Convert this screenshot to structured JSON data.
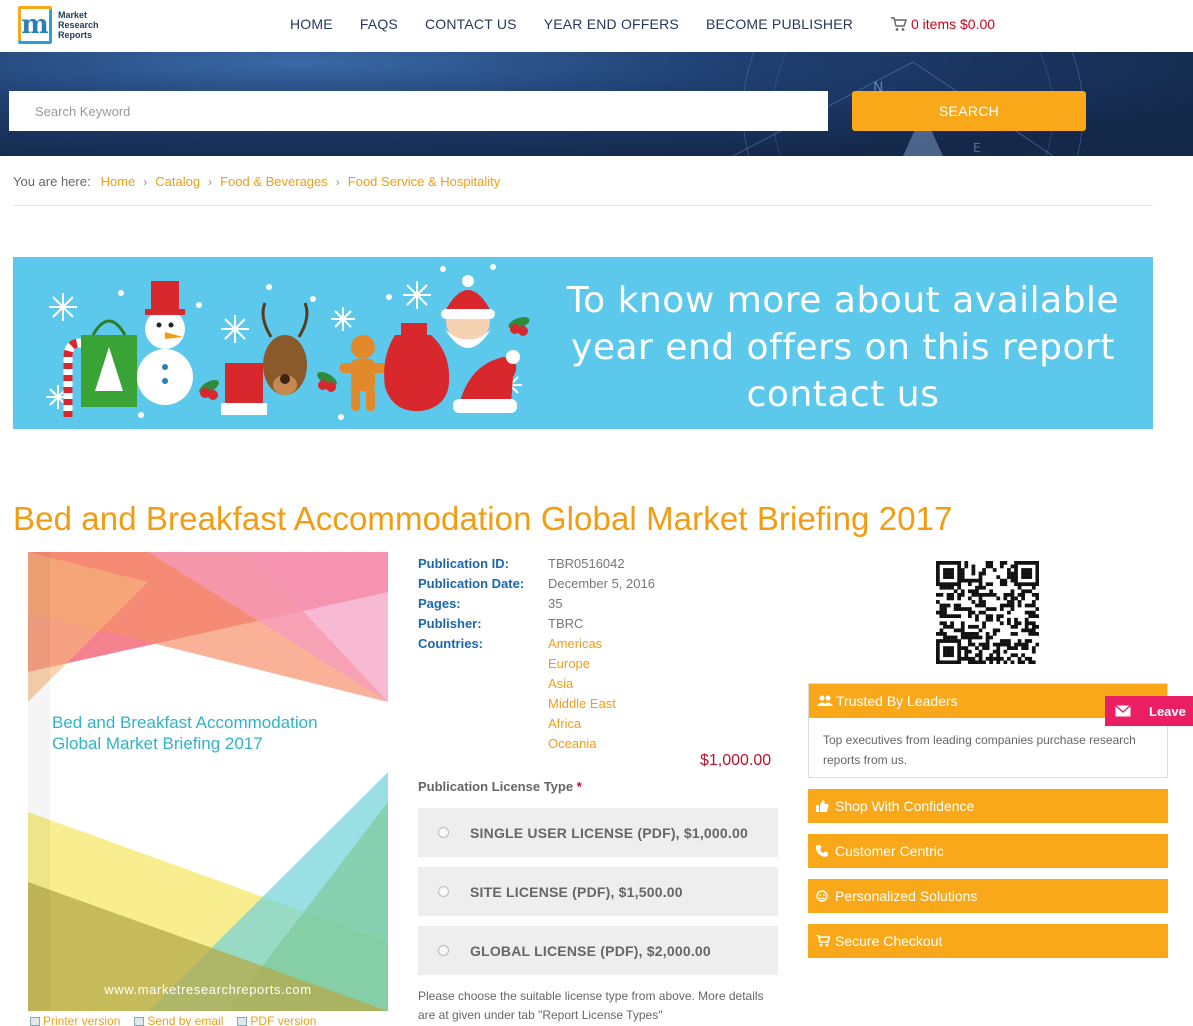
{
  "header": {
    "logo_text_1": "Market",
    "logo_text_2": "Research",
    "logo_text_3": "Reports",
    "nav": [
      "HOME",
      "FAQS",
      "CONTACT US",
      "YEAR END OFFERS",
      "BECOME PUBLISHER"
    ],
    "cart": "0 items $0.00"
  },
  "search": {
    "placeholder": "Search Keyword",
    "button": "SEARCH"
  },
  "breadcrumb": {
    "prefix": "You are here:",
    "items": [
      "Home",
      "Catalog",
      "Food & Beverages",
      "Food Service & Hospitality"
    ]
  },
  "promo": {
    "line1": "To know more about available",
    "line2": "year end offers on this report",
    "line3": "contact us"
  },
  "report": {
    "title": "Bed and Breakfast Accommodation Global Market Briefing 2017",
    "cover_title_1": "Bed and Breakfast Accommodation",
    "cover_title_2": "Global Market Briefing 2017",
    "cover_url": "www.marketresearchreports.com",
    "tools": [
      "Printer version",
      "Send by email",
      "PDF version"
    ]
  },
  "meta": {
    "publication_id_label": "Publication ID:",
    "publication_id": "TBR0516042",
    "publication_date_label": "Publication Date:",
    "publication_date": "December 5, 2016",
    "pages_label": "Pages:",
    "pages": "35",
    "publisher_label": "Publisher:",
    "publisher": "TBRC",
    "countries_label": "Countries:",
    "countries": [
      "Americas",
      "Europe",
      "Asia",
      "Middle East",
      "Africa",
      "Oceania"
    ]
  },
  "pricing": {
    "price": "$1,000.00",
    "license_label": "Publication License Type",
    "required": "*",
    "licenses": [
      "SINGLE USER LICENSE (PDF), $1,000.00",
      "SITE LICENSE (PDF), $1,500.00",
      "GLOBAL LICENSE (PDF), $2,000.00"
    ],
    "note": "Please choose the suitable license type from above. More details are at given under tab \"Report License Types\""
  },
  "sidebar": {
    "trusted_title": "Trusted By Leaders",
    "trusted_body": "Top executives from leading companies purchase research reports from us.",
    "bars": [
      "Shop With Confidence",
      "Customer Centric",
      "Personalized Solutions",
      "Secure Checkout"
    ]
  },
  "leave": {
    "label": "Leave"
  },
  "colors": {
    "accent": "#f9a81a",
    "link": "#f39c12",
    "nav": "#23395d",
    "price": "#c0102b",
    "promo_bg": "#5cc9ec",
    "leave": "#e91e63"
  }
}
